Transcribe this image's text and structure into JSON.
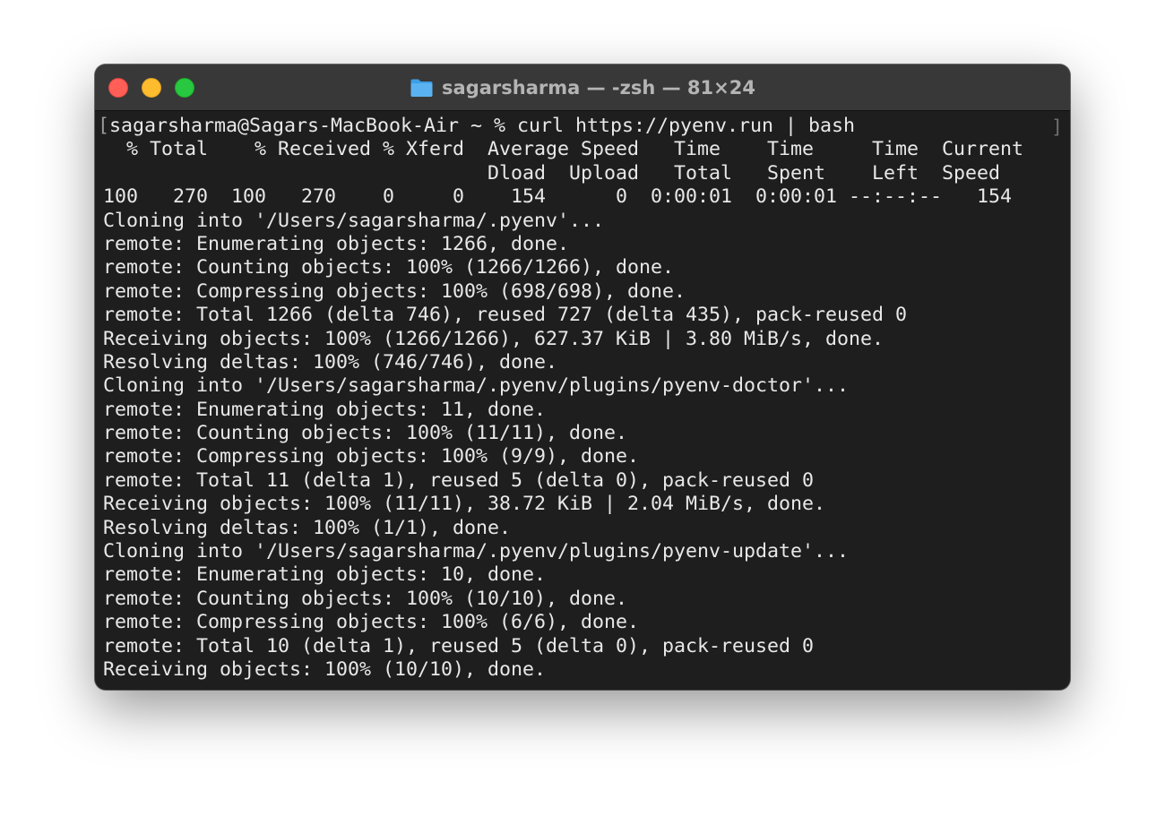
{
  "window": {
    "title": "sagarsharma — -zsh — 81×24",
    "title_icon": "folder-icon",
    "buttons": {
      "close": "close-button",
      "minimize": "minimize-button",
      "zoom": "zoom-button"
    }
  },
  "colors": {
    "close": "#ff5f57",
    "minimize": "#febc2e",
    "zoom": "#28c840",
    "terminal_bg": "#1e1e1e",
    "titlebar_bg": "#383838",
    "text": "#e8e8e8",
    "folder_icon": "#5ab3f0"
  },
  "terminal": {
    "prompt": "sagarsharma@Sagars-MacBook-Air ~ % curl https://pyenv.run | bash",
    "lines": [
      "  % Total    % Received % Xferd  Average Speed   Time    Time     Time  Current",
      "                                 Dload  Upload   Total   Spent    Left  Speed",
      "100   270  100   270    0     0    154      0  0:00:01  0:00:01 --:--:--   154",
      "Cloning into '/Users/sagarsharma/.pyenv'...",
      "remote: Enumerating objects: 1266, done.",
      "remote: Counting objects: 100% (1266/1266), done.",
      "remote: Compressing objects: 100% (698/698), done.",
      "remote: Total 1266 (delta 746), reused 727 (delta 435), pack-reused 0",
      "Receiving objects: 100% (1266/1266), 627.37 KiB | 3.80 MiB/s, done.",
      "Resolving deltas: 100% (746/746), done.",
      "Cloning into '/Users/sagarsharma/.pyenv/plugins/pyenv-doctor'...",
      "remote: Enumerating objects: 11, done.",
      "remote: Counting objects: 100% (11/11), done.",
      "remote: Compressing objects: 100% (9/9), done.",
      "remote: Total 11 (delta 1), reused 5 (delta 0), pack-reused 0",
      "Receiving objects: 100% (11/11), 38.72 KiB | 2.04 MiB/s, done.",
      "Resolving deltas: 100% (1/1), done.",
      "Cloning into '/Users/sagarsharma/.pyenv/plugins/pyenv-update'...",
      "remote: Enumerating objects: 10, done.",
      "remote: Counting objects: 100% (10/10), done.",
      "remote: Compressing objects: 100% (6/6), done.",
      "remote: Total 10 (delta 1), reused 5 (delta 0), pack-reused 0",
      "Receiving objects: 100% (10/10), done."
    ]
  }
}
